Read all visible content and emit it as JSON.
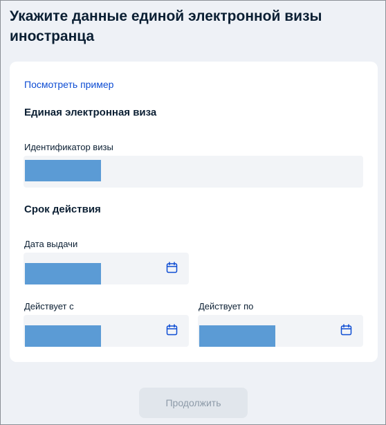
{
  "page": {
    "title": "Укажите данные единой электронной визы иностранца"
  },
  "form": {
    "example_link": "Посмотреть пример",
    "visa_section_title": "Единая электронная виза",
    "visa_id_label": "Идентификатор визы",
    "validity_section_title": "Срок действия",
    "issue_date_label": "Дата выдачи",
    "valid_from_label": "Действует с",
    "valid_to_label": "Действует по"
  },
  "actions": {
    "continue_label": "Продолжить"
  },
  "icons": {
    "calendar": "calendar-icon"
  },
  "colors": {
    "link": "#0d4cd3",
    "redaction": "#5b9bd5",
    "field_bg": "#f2f4f7"
  }
}
